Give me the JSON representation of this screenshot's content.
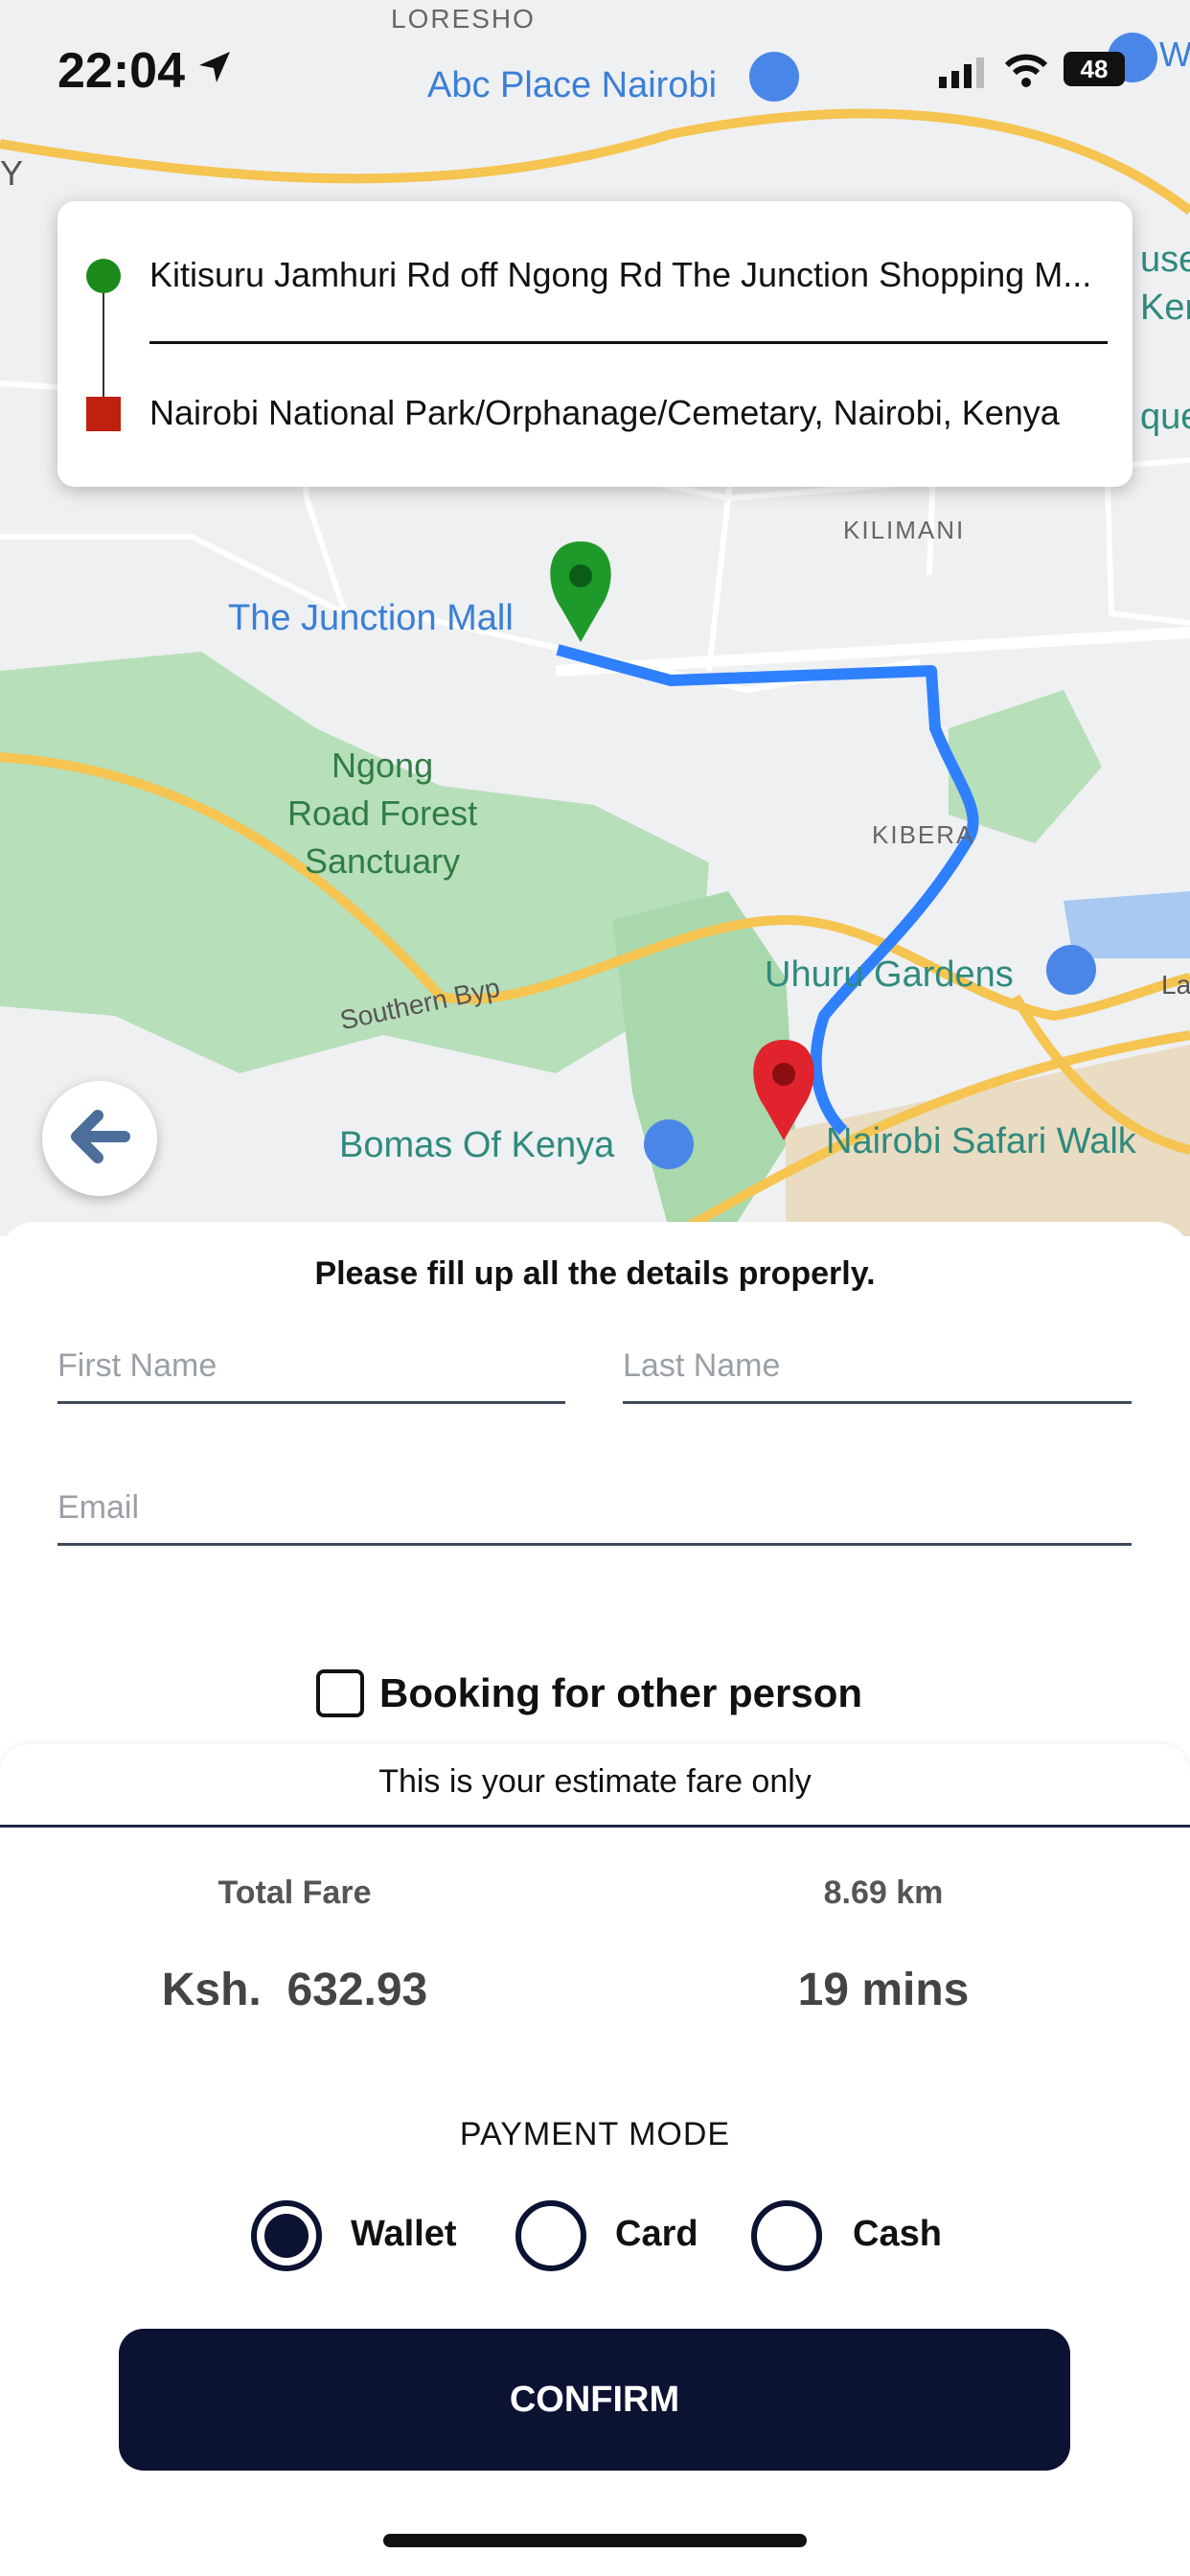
{
  "status_bar": {
    "time": "22:04",
    "battery": "48"
  },
  "map": {
    "labels": {
      "loresho": "LORESHO",
      "abc_place": "Abc Place Nairobi",
      "junction_mall": "The Junction Mall",
      "kilimani": "KILIMANI",
      "ngong_forest": "Ngong\nRoad Forest\nSanctuary",
      "kibera": "KIBERA",
      "uhuru_gardens": "Uhuru Gardens",
      "southern_byp": "Southern Byp",
      "bomas": "Bomas Of Kenya",
      "safari_walk": "Nairobi Safari Walk",
      "edge_y": "Y",
      "edge_w": "W",
      "edge_use": "use",
      "edge_ken": "Ken",
      "edge_que": "que",
      "edge_la": "La"
    },
    "colors": {
      "road": "#f5c451",
      "park": "#b7dfb9",
      "route": "#2f80ff",
      "origin_pin": "#1e9a2a",
      "dest_pin": "#e0232c"
    }
  },
  "route": {
    "origin": "Kitisuru Jamhuri Rd off Ngong Rd The Junction Shopping M...",
    "destination": "Nairobi National Park/Orphanage/Cemetary, Nairobi, Kenya"
  },
  "form": {
    "notice": "Please fill up all the details properly.",
    "first_name_placeholder": "First Name",
    "last_name_placeholder": "Last Name",
    "email_placeholder": "Email",
    "booking_other_label": "Booking for other person",
    "booking_other_checked": false
  },
  "fare": {
    "estimate_note": "This is your estimate fare only",
    "total_fare_label": "Total Fare",
    "total_fare_value": "Ksh.  632.93",
    "distance_label": "8.69 km",
    "duration_value": "19 mins"
  },
  "payment": {
    "title": "PAYMENT MODE",
    "options": [
      "Wallet",
      "Card",
      "Cash"
    ],
    "selected": "Wallet"
  },
  "confirm_label": "CONFIRM",
  "icons": {
    "back": "arrow-left-icon",
    "location": "location-arrow-icon"
  }
}
